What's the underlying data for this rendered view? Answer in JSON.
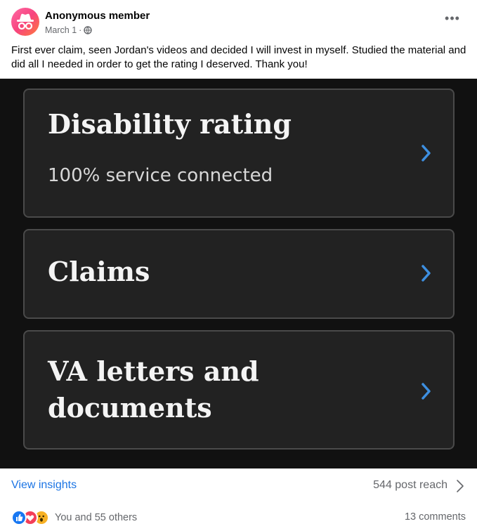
{
  "post": {
    "author": "Anonymous member",
    "date": "March 1",
    "separator": "·",
    "audience_icon": "globe-icon",
    "more_icon": "more-options-icon",
    "more_label": "•••",
    "text": "First ever claim, seen Jordan's videos and decided I will invest in myself. Studied the material and did all I needed in order to get the rating I deserved. Thank you!"
  },
  "image": {
    "cards": [
      {
        "title": "Disability rating",
        "subtitle": "100% service connected",
        "icon": "chevron-right-icon"
      },
      {
        "title": "Claims",
        "icon": "chevron-right-icon"
      },
      {
        "title": "VA letters and documents",
        "title_line1": "VA letters and",
        "title_line2": "documents",
        "icon": "chevron-right-icon"
      }
    ],
    "colors": {
      "background": "#111111",
      "card": "#222222",
      "border": "#4a4a4a",
      "chevron": "#3d8fe0"
    }
  },
  "insights": {
    "link_label": "View insights",
    "reach_label": "544 post reach"
  },
  "engagement": {
    "reaction_icons": [
      "like-icon",
      "love-icon",
      "wow-icon"
    ],
    "reactors_label": "You and 55 others",
    "comments_label": "13 comments"
  },
  "colors": {
    "link": "#1b74e4",
    "muted": "#65676b",
    "text": "#050505"
  }
}
